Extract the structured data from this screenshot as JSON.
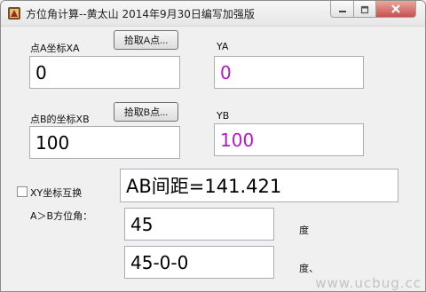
{
  "window": {
    "title": "方位角计算--黄太山 2014年9月30日编写加强版"
  },
  "point_a": {
    "label": "点A坐标XA",
    "pick_button": "拾取A点...",
    "xa_value": "0",
    "ya_label": "YA",
    "ya_value": "0"
  },
  "point_b": {
    "label": "点B的坐标XB",
    "pick_button": "拾取B点...",
    "xb_value": "100",
    "yb_label": "YB",
    "yb_value": "100"
  },
  "swap": {
    "label": "XY坐标互换",
    "checked": false
  },
  "distance": {
    "value": "AB间距=141.421"
  },
  "azimuth": {
    "label": "A＞B方位角：",
    "degrees_value": "45",
    "degrees_unit": "度",
    "dms_value": "45-0-0",
    "dms_unit": "度、"
  },
  "watermark": {
    "text": "www.ucbug.cc"
  },
  "colors": {
    "purple_value": "#b418c9",
    "close_red": "#c75050"
  }
}
